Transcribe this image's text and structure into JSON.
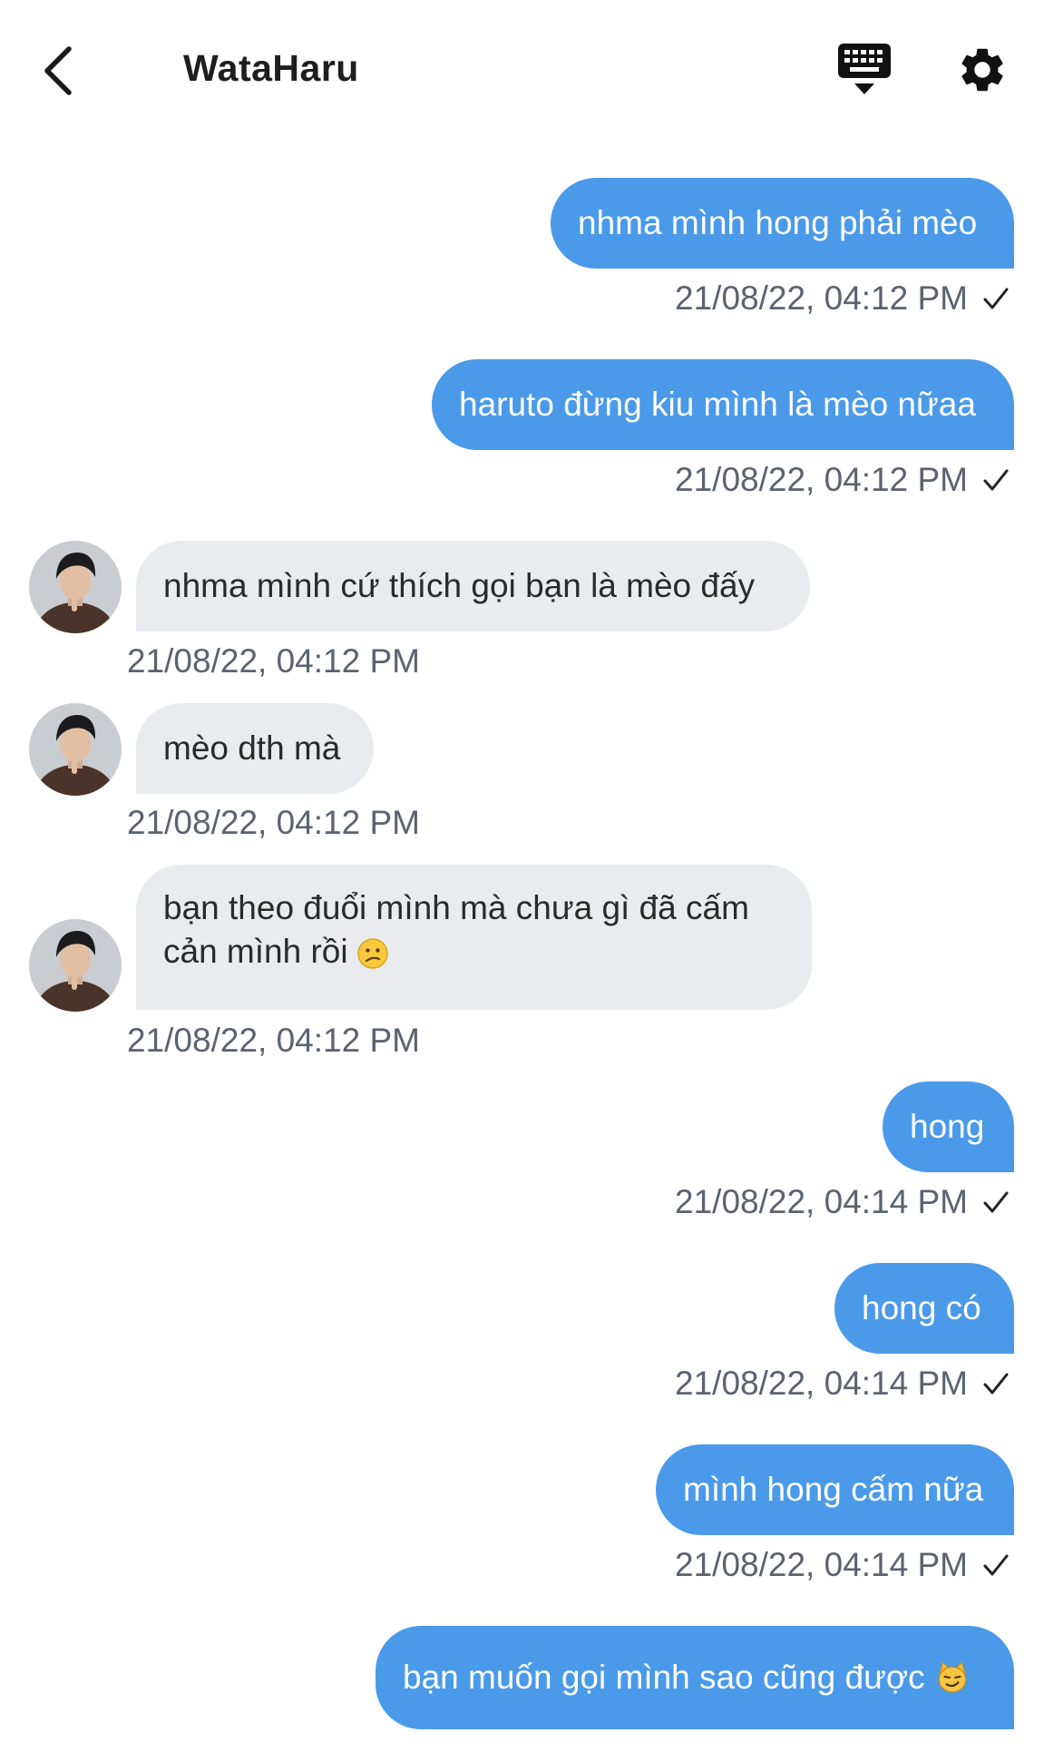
{
  "header": {
    "title": "WataHaru"
  },
  "colors": {
    "outgoing_bubble": "#4a9ae9",
    "incoming_bubble": "#eaebef",
    "timestamp": "#5b6270"
  },
  "messages": [
    {
      "dir": "out",
      "text": "nhma mình hong phải mèo",
      "time": "21/08/22, 04:12 PM"
    },
    {
      "dir": "out",
      "text": "haruto đừng kiu mình là mèo nữaa",
      "time": "21/08/22, 04:12 PM"
    },
    {
      "dir": "in",
      "text": "nhma mình cứ thích gọi bạn là mèo đấy",
      "time": "21/08/22, 04:12 PM"
    },
    {
      "dir": "in",
      "text": "mèo dth mà",
      "time": "21/08/22, 04:12 PM"
    },
    {
      "dir": "in",
      "text": "bạn theo đuổi mình mà chưa gì đã cấm cản mình rồi",
      "emoji": "confused-face",
      "time": "21/08/22, 04:12 PM"
    },
    {
      "dir": "out",
      "text": "hong",
      "time": "21/08/22, 04:14 PM"
    },
    {
      "dir": "out",
      "text": "hong có",
      "time": "21/08/22, 04:14 PM"
    },
    {
      "dir": "out",
      "text": "mình hong cấm nữa",
      "time": "21/08/22, 04:14 PM"
    },
    {
      "dir": "out",
      "text": "bạn muốn gọi mình sao cũng được",
      "emoji": "smirking-cat-face"
    }
  ]
}
